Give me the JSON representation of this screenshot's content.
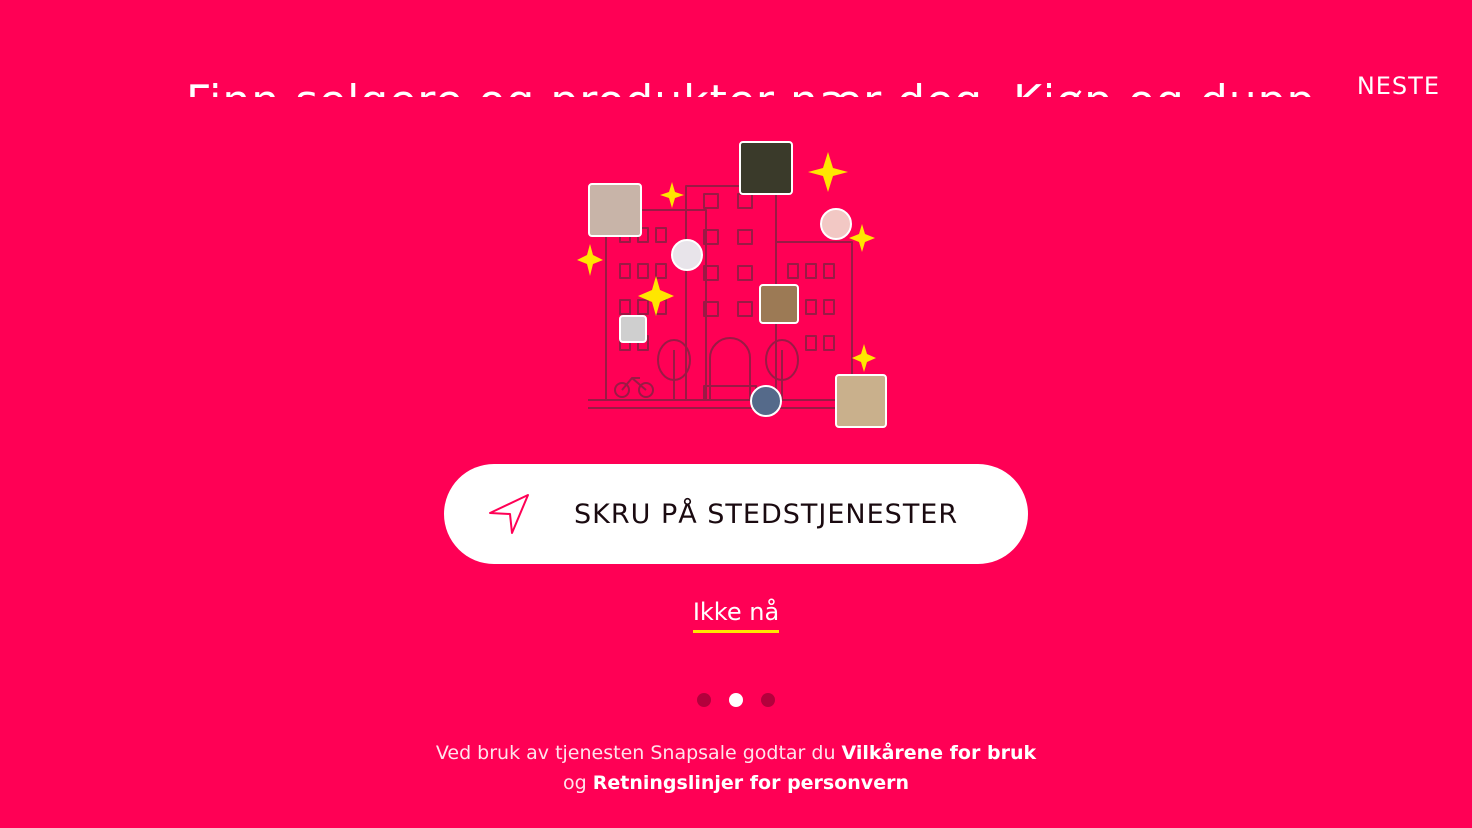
{
  "header": {
    "partial_text": "Finn selgere og produkter nær deg. Kjøp og dupp av",
    "next_label": "NESTE"
  },
  "illustration": {
    "icon": "city-building-illustration"
  },
  "location_button": {
    "label": "SKRU PÅ STEDSTJENESTER",
    "icon": "location-arrow-icon"
  },
  "not_now_label": "Ikke nå",
  "pagination": {
    "total": 3,
    "active_index": 1
  },
  "terms": {
    "prefix": "Ved bruk av tjenesten Snapsale godtar du ",
    "terms_link": "Vilkårene for bruk",
    "conjunction": " og ",
    "privacy_link": "Retningslinjer for personvern"
  },
  "colors": {
    "background": "#ff0055",
    "accent_underline": "#ffe600",
    "sparkle": "#ffe600",
    "button_bg": "#ffffff"
  }
}
